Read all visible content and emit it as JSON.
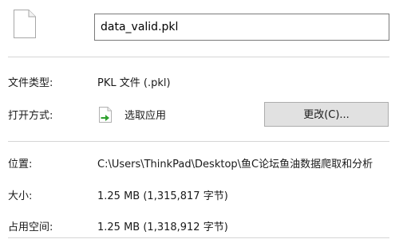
{
  "file": {
    "icon": "file-icon",
    "name": "data_valid.pkl"
  },
  "properties": {
    "type_label": "文件类型:",
    "type_value": "PKL 文件 (.pkl)",
    "opens_with_label": "打开方式:",
    "opens_with_app": "选取应用",
    "opens_with_icon": "choose-app-icon",
    "change_button_label": "更改(C)...",
    "location_label": "位置:",
    "location_value": "C:\\Users\\ThinkPad\\Desktop\\鱼C论坛鱼油数据爬取和分析",
    "size_label": "大小:",
    "size_value": "1.25 MB (1,315,817 字节)",
    "size_on_disk_label": "占用空间:",
    "size_on_disk_value": "1.25 MB (1,318,912 字节)"
  },
  "colors": {
    "divider": "#d5d5d5",
    "button_face": "#e1e1e1",
    "button_border": "#adadad",
    "field_border": "#7a7a7a",
    "arrow_green": "#2fa12f"
  }
}
